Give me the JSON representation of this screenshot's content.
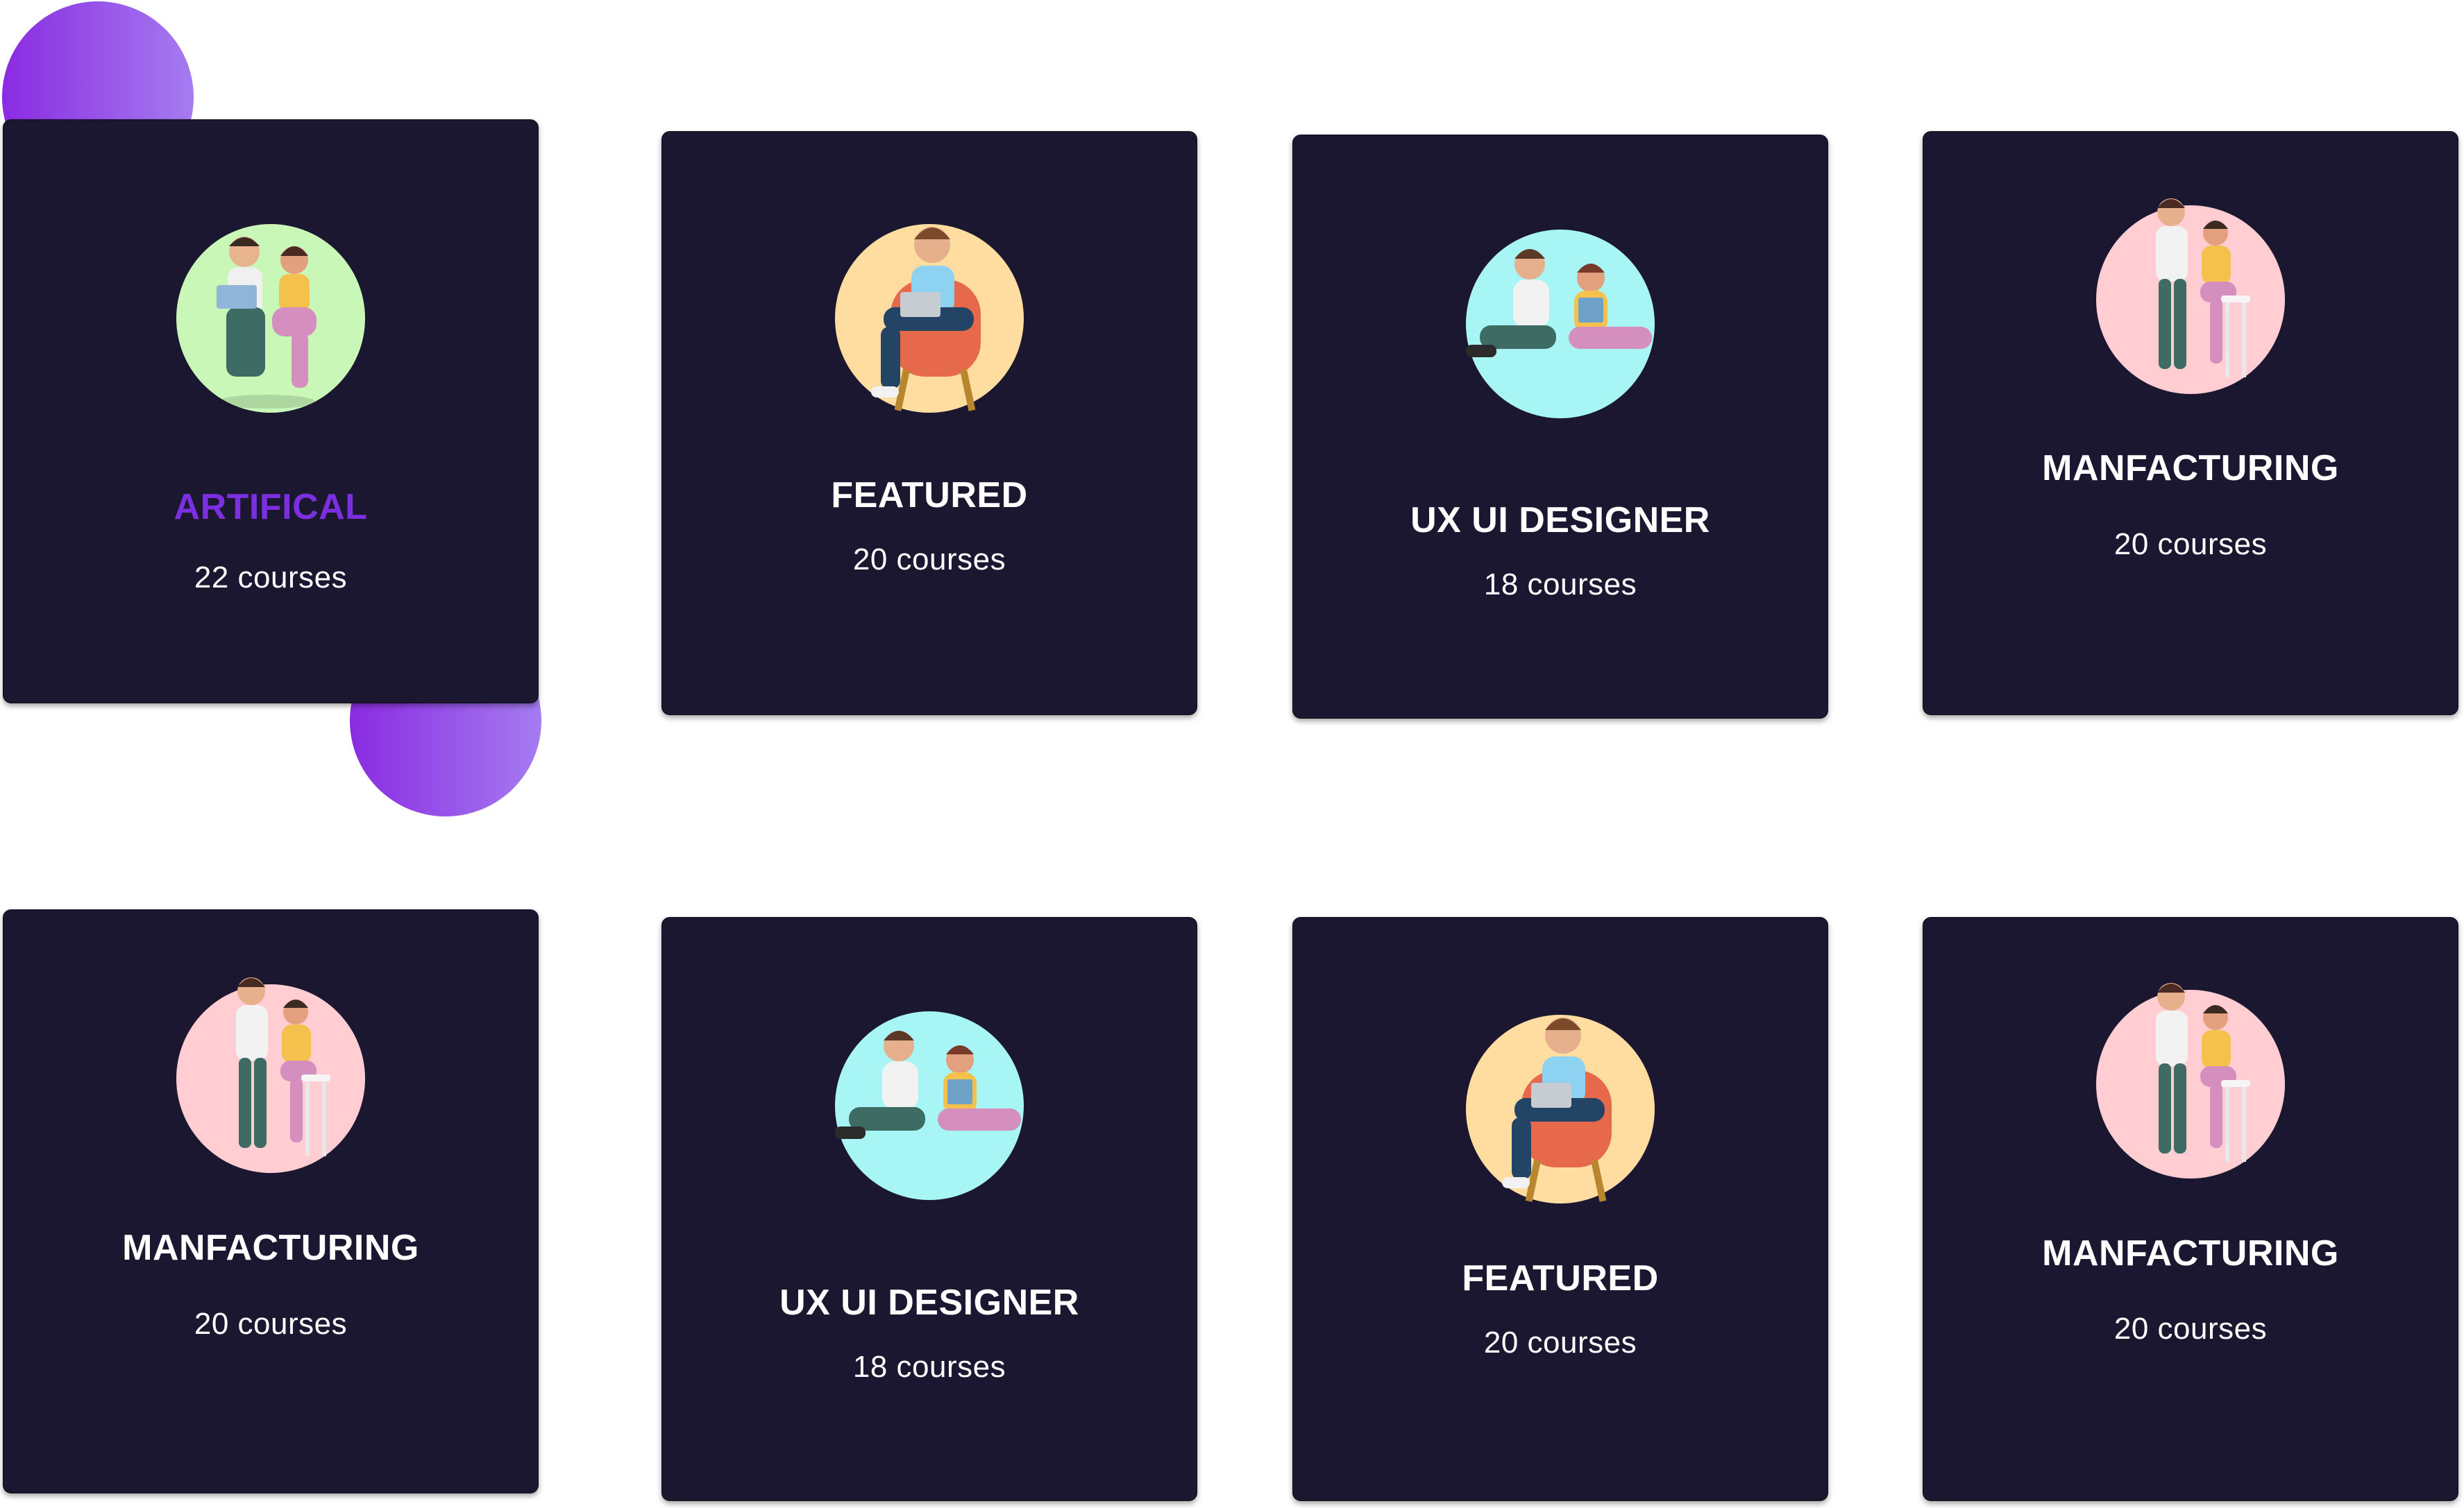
{
  "accent_color": "#7b2fe0",
  "card_background": "#1b1730",
  "categories": [
    {
      "title": "ARTIFICAL",
      "count": "22 courses",
      "active": true,
      "illustration": "couple-with-laptop-icon",
      "circle_color": "#c9f7b8"
    },
    {
      "title": "FEATURED",
      "count": "20 courses",
      "active": false,
      "illustration": "man-in-armchair-icon",
      "circle_color": "#ffdca0"
    },
    {
      "title": "UX UI DESIGNER",
      "count": "18  courses",
      "active": false,
      "illustration": "couple-sitting-icon",
      "circle_color": "#a8f5f5"
    },
    {
      "title": "MANFACTURING",
      "count": "20 courses",
      "active": false,
      "illustration": "couple-standing-icon",
      "circle_color": "#ffcdd2"
    },
    {
      "title": "MANFACTURING",
      "count": "20 courses",
      "active": false,
      "illustration": "couple-standing-icon",
      "circle_color": "#ffcdd2"
    },
    {
      "title": "UX UI DESIGNER",
      "count": "18  courses",
      "active": false,
      "illustration": "couple-sitting-icon",
      "circle_color": "#a8f5f5"
    },
    {
      "title": "FEATURED",
      "count": "20 courses",
      "active": false,
      "illustration": "man-in-armchair-icon",
      "circle_color": "#ffdca0"
    },
    {
      "title": "MANFACTURING",
      "count": "20 courses",
      "active": false,
      "illustration": "couple-standing-icon",
      "circle_color": "#ffcdd2"
    }
  ]
}
